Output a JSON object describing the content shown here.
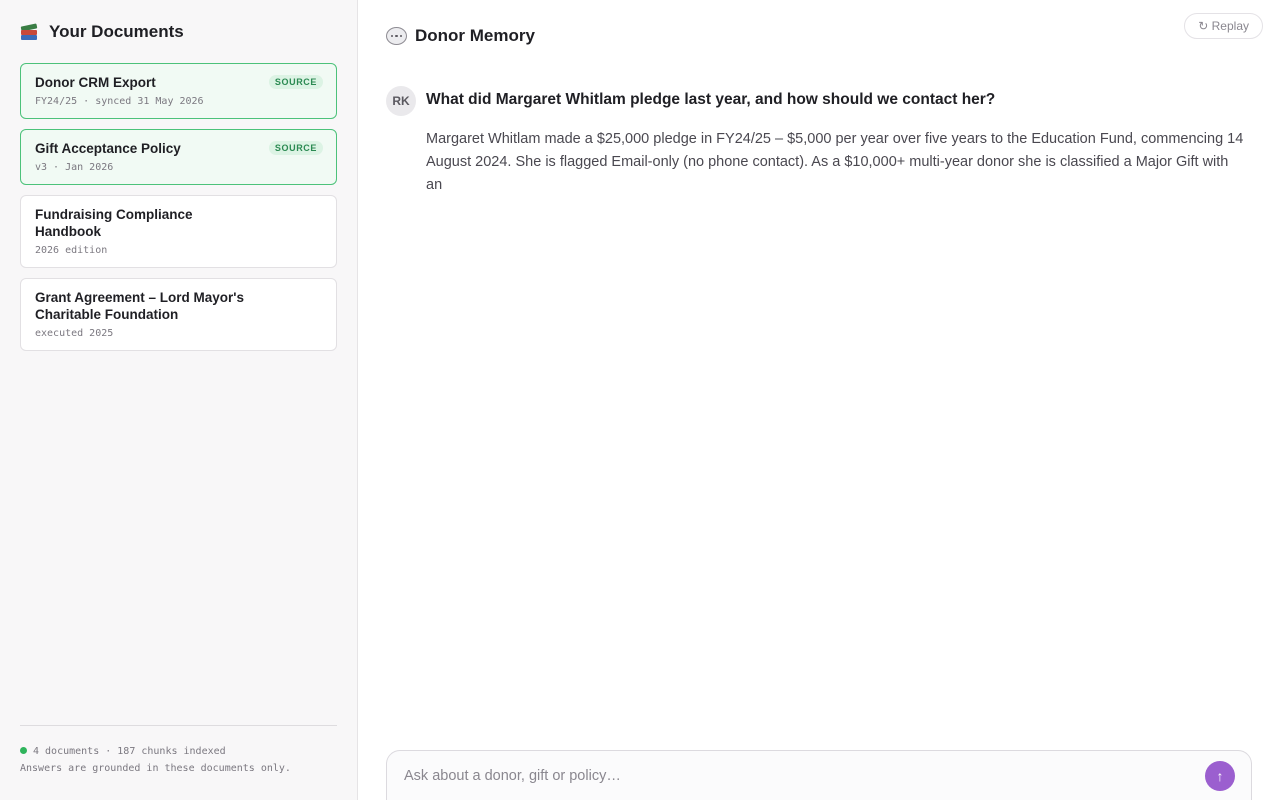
{
  "sidebar": {
    "title": "Your Documents",
    "icon": "books-icon",
    "documents": [
      {
        "title": "Donor CRM Export",
        "meta": "FY24/25 · synced 31 May 2026",
        "badge": "SOURCE",
        "active": true
      },
      {
        "title": "Gift Acceptance Policy",
        "meta": "v3 · Jan 2026",
        "badge": "SOURCE",
        "active": true
      },
      {
        "title": "Fundraising Compliance Handbook",
        "meta": "2026 edition",
        "active": false
      },
      {
        "title": "Grant Agreement – Lord Mayor's Charitable Foundation",
        "meta": "executed 2025",
        "active": false
      }
    ],
    "footer": {
      "status": "4 documents · 187 chunks indexed",
      "note": "Answers are grounded in these documents only.",
      "status_color": "#2fb45c"
    }
  },
  "main": {
    "title": "Donor Memory",
    "icon": "chat-bubble-icon",
    "replay_label": "↻ Replay",
    "conversation": {
      "user_initials": "RK",
      "question": "What did Margaret Whitlam pledge last year, and how should we contact her?",
      "answer": "Margaret Whitlam made a $25,000 pledge in FY24/25 – $5,000 per year over five years to the Education Fund, commencing 14 August 2024. She is flagged Email-only (no phone contact). As a $10,000+ multi-year donor she is classified a Major Gift with an"
    },
    "composer": {
      "placeholder": "Ask about a donor, gift or policy…",
      "send_icon": "arrow-up-icon"
    }
  },
  "colors": {
    "accent": "#9b5fcf",
    "source_border": "#4cc27a",
    "source_badge": "#2b8a52"
  }
}
